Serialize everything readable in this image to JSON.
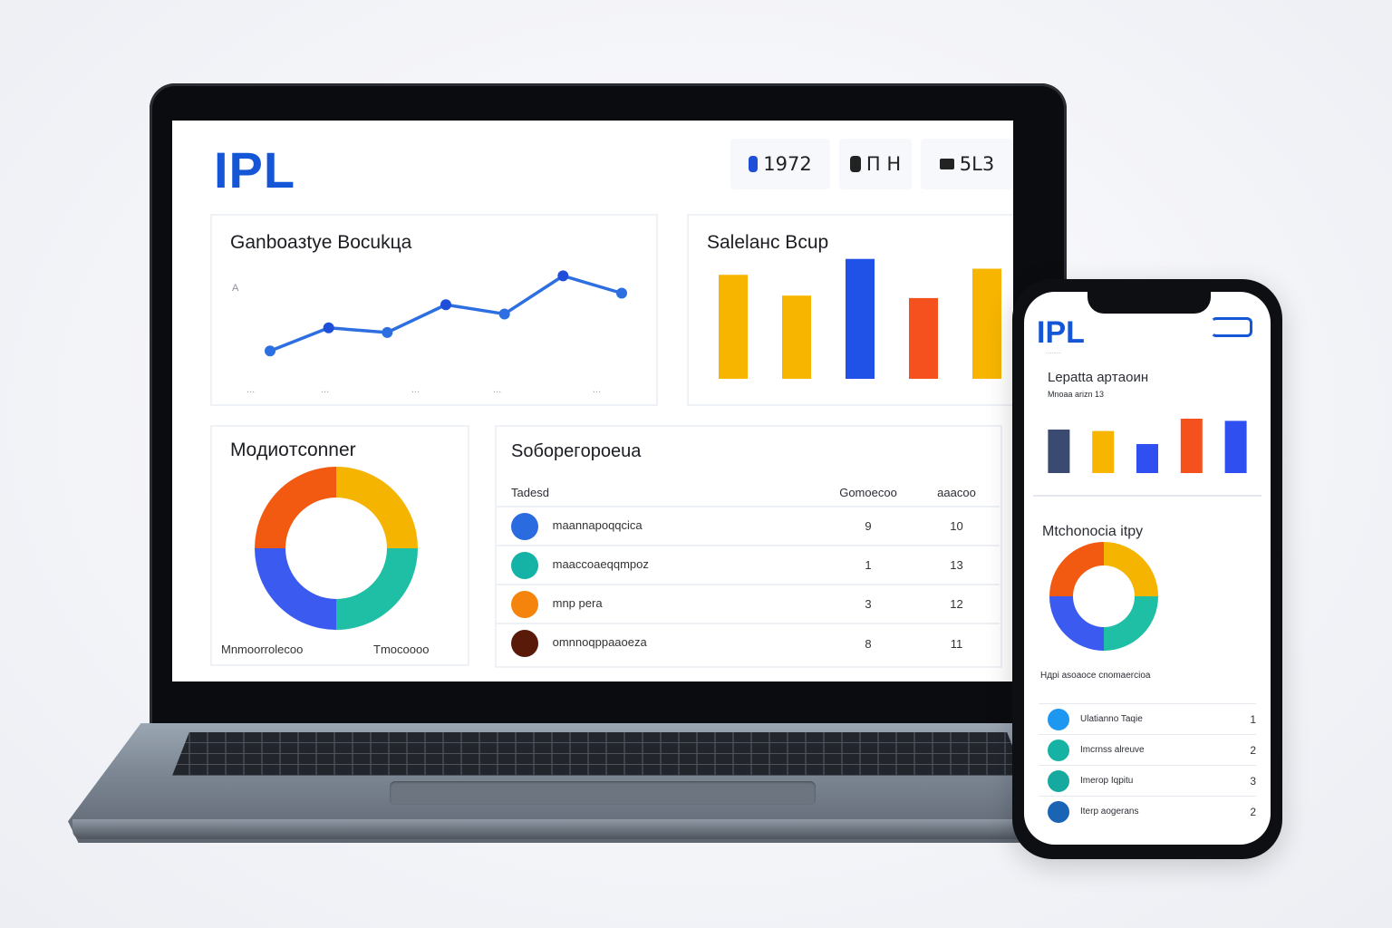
{
  "dashboard": {
    "logo": "IPL",
    "stats": [
      {
        "value": "1972",
        "icon": "pill-icon"
      },
      {
        "value": "П Н",
        "icon": "grid-icon"
      },
      {
        "value": "5L3",
        "icon": "stack-icon"
      }
    ],
    "line_card": {
      "title": "Ganboaзtye Bocukца",
      "y_label": "A",
      "x_ticks": [
        "...",
        "...",
        "...",
        "...",
        "..."
      ]
    },
    "bar_card": {
      "title": "Salelaнc Bcup"
    },
    "donut_card": {
      "title": "Moдиoтconner",
      "legend_left": "Mnmoorrolecoo",
      "legend_right": "Tmocoooo"
    },
    "table_card": {
      "title": "Soбopeгopoeua",
      "headers": [
        "Tadesd",
        "Gomoecoo",
        "aaacoo"
      ],
      "rows": [
        {
          "label": "maannapoqqcica",
          "c1": "9",
          "c2": "10",
          "color": "#2a6be0"
        },
        {
          "label": "maaccoaeqqmpoz",
          "c1": "1",
          "c2": "13",
          "color": "#14b3a6"
        },
        {
          "label": "mnp pera",
          "c1": "3",
          "c2": "12",
          "color": "#f5840c"
        },
        {
          "label": "omnnoqppaaoeza",
          "c1": "8",
          "c2": "11",
          "color": "#5a1a0a"
        }
      ]
    },
    "chart_data": [
      {
        "type": "line",
        "title": "Ganboaзtye Bocukца",
        "series": [
          {
            "values": [
              1,
              3,
              2.6,
              5,
              4.2,
              7.5,
              6
            ]
          }
        ]
      },
      {
        "type": "bar",
        "title": "Salelaнc Bcup",
        "values": [
          85,
          68,
          98,
          66,
          90
        ],
        "colors": [
          "#f7b500",
          "#f7b500",
          "#2152e8",
          "#f4511e",
          "#f7b500"
        ],
        "ylim": [
          0,
          100
        ]
      },
      {
        "type": "pie",
        "title": "Moдиoтconner",
        "values": [
          25,
          25,
          25,
          25
        ],
        "colors": [
          "#f5b400",
          "#1fbfa5",
          "#3b5af0",
          "#f25a12"
        ]
      }
    ]
  },
  "phone": {
    "logo": "IPL",
    "logo_sub": "..........",
    "bar_title": "Lepatta apтaoин",
    "bar_subtitle": "Mnoaa arizn 13",
    "donut_title": "Mtchonocia itpy",
    "donut_caption": "Hдpi asoaoce cnomaercioa",
    "rows": [
      {
        "label": "Ulatianno Taqie",
        "value": "1",
        "color": "#1c98f0"
      },
      {
        "label": "Imcrnss alreuve",
        "value": "2",
        "color": "#16b3a4"
      },
      {
        "label": "Imerop Iqpitu",
        "value": "3",
        "color": "#15a9a0"
      },
      {
        "label": "Iterp aogerans",
        "value": "2",
        "color": "#1964b5"
      }
    ],
    "chart_data": [
      {
        "type": "bar",
        "values": [
          60,
          58,
          40,
          75,
          72
        ],
        "colors": [
          "#3b4a70",
          "#f7b500",
          "#2f4ff0",
          "#f4511e",
          "#2f4ff0"
        ],
        "ylim": [
          0,
          100
        ]
      },
      {
        "type": "pie",
        "values": [
          25,
          25,
          25,
          25
        ],
        "colors": [
          "#f5b400",
          "#1fbfa5",
          "#3b5af0",
          "#f25a12"
        ]
      }
    ]
  }
}
